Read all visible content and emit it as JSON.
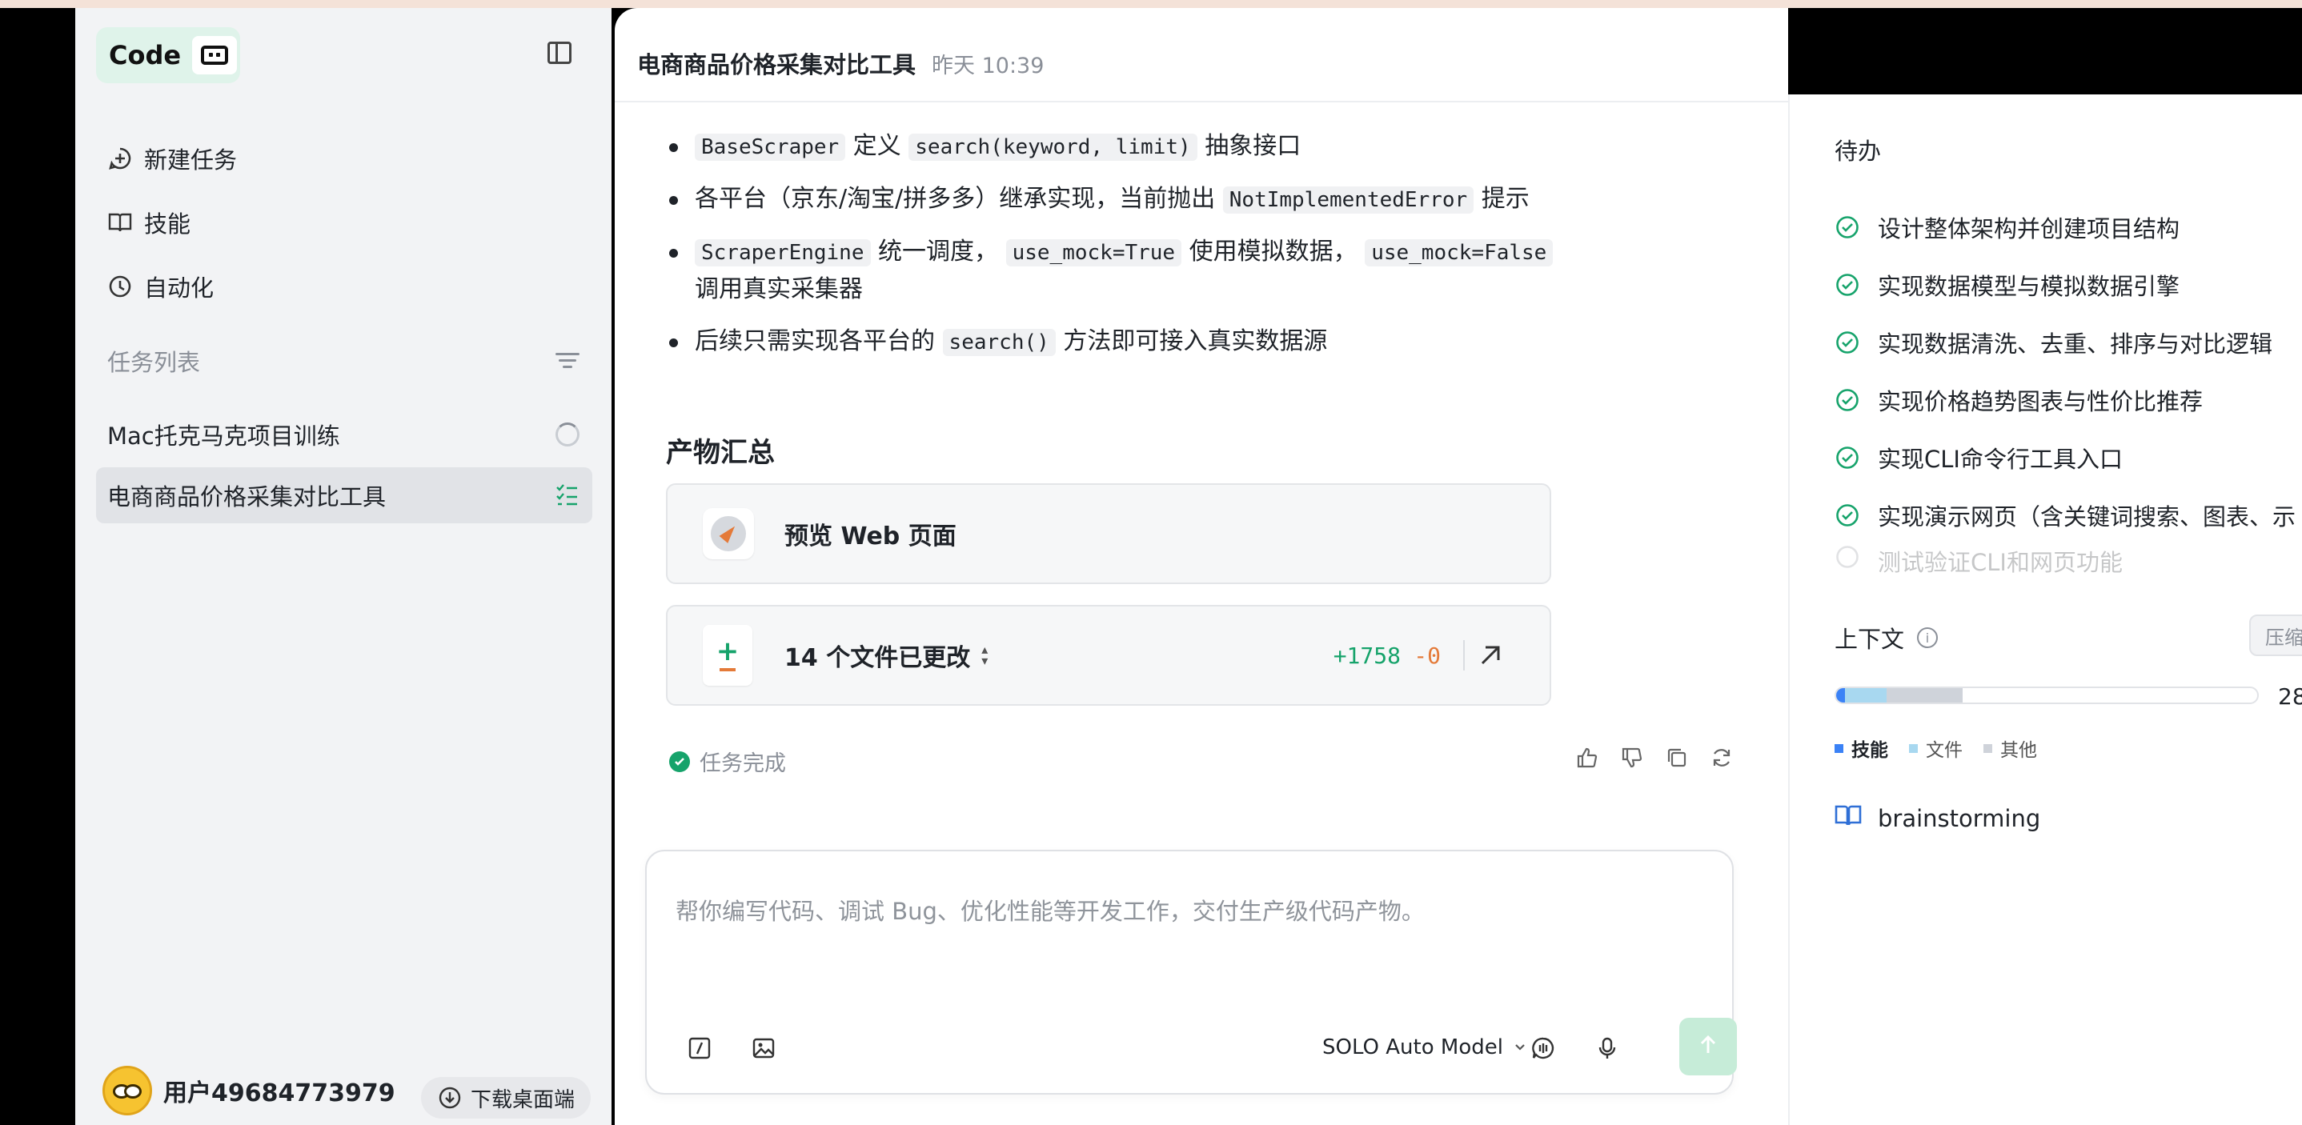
{
  "sidebar": {
    "logo_text": "Code",
    "nav": [
      {
        "label": "新建任务",
        "icon": "new-task-icon"
      },
      {
        "label": "技能",
        "icon": "book-icon"
      },
      {
        "label": "自动化",
        "icon": "clock-icon"
      }
    ],
    "tasks_header": "任务列表",
    "tasks": [
      {
        "label": "Mac托克马克项目训练",
        "status": "loading"
      },
      {
        "label": "电商商品价格采集对比工具",
        "status": "active"
      }
    ],
    "user_name": "用户49684773979",
    "download_label": "下载桌面端"
  },
  "header": {
    "title": "电商商品价格采集对比工具",
    "time": "昨天 10:39"
  },
  "content": {
    "b1_code1": "BaseScraper",
    "b1_text1": "定义",
    "b1_code2": "search(keyword, limit)",
    "b1_text2": "抽象接口",
    "b2_text1": "各平台（京东/淘宝/拼多多）继承实现，当前抛出",
    "b2_code1": "NotImplementedError",
    "b2_text2": "提示",
    "b3_code1": "ScraperEngine",
    "b3_text1": "统一调度，",
    "b3_code2": "use_mock=True",
    "b3_text2": "使用模拟数据，",
    "b3_code3": "use_mock=False",
    "b3_text3": "调用真实采集器",
    "b4_text1": "后续只需实现各平台的",
    "b4_code1": "search()",
    "b4_text2": "方法即可接入真实数据源",
    "section_title": "产物汇总",
    "preview_label": "预览 Web 页面",
    "files_label": "14 个文件已更改",
    "additions": "+1758",
    "deletions": "-0",
    "done_label": "任务完成"
  },
  "input": {
    "placeholder": "帮你编写代码、调试 Bug、优化性能等开发工作，交付生产级代码产物。",
    "model": "SOLO Auto Model"
  },
  "right": {
    "todo_title": "待办",
    "todos": [
      "设计整体架构并创建项目结构",
      "实现数据模型与模拟数据引擎",
      "实现数据清洗、去重、排序与对比逻辑",
      "实现价格趋势图表与性价比推荐",
      "实现CLI命令行工具入口",
      "实现演示网页（含关键词搜索、图表、示",
      "测试验证CLI和网页功能"
    ],
    "context_title": "上下文",
    "compress_label": "压缩",
    "context_number": "28",
    "context_fill": {
      "skills": 0.02,
      "files": 0.1,
      "other": 0.18
    },
    "legend": [
      "技能",
      "文件",
      "其他"
    ],
    "skill_name": "brainstorming"
  },
  "colors": {
    "accent": "#16a36b",
    "deletion": "#e47a39",
    "skills": "#3b82f6",
    "files": "#a8d8f0",
    "other": "#cfd3da"
  }
}
